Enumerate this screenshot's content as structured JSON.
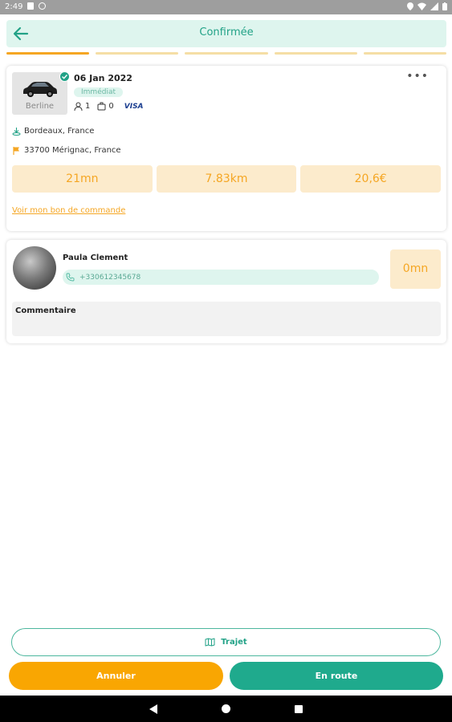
{
  "status_bar": {
    "time": "2:49"
  },
  "header": {
    "title": "Confirmée",
    "back_icon": "arrow-left-icon"
  },
  "progress": {
    "segments": 5,
    "active": 1
  },
  "booking": {
    "vehicle_label": "Berline",
    "date": "06 Jan 2022",
    "badge": "Immédiat",
    "passengers": "1",
    "luggage": "0",
    "payment": "VISA",
    "pickup": "Bordeaux, France",
    "dropoff": "33700 Mérignac, France",
    "duration": "21mn",
    "distance": "7.83km",
    "price": "20,6€",
    "order_link": "Voir mon bon de commande"
  },
  "client": {
    "name": "Paula Clement",
    "phone": "+330612345678",
    "eta": "0mn",
    "comment_label": "Commentaire"
  },
  "actions": {
    "trajet": "Trajet",
    "cancel": "Annuler",
    "en_route": "En route"
  },
  "colors": {
    "accent_green": "#1faa8d",
    "accent_orange": "#f9a602",
    "light_green": "#def5ee",
    "light_orange": "#fcebcc"
  }
}
